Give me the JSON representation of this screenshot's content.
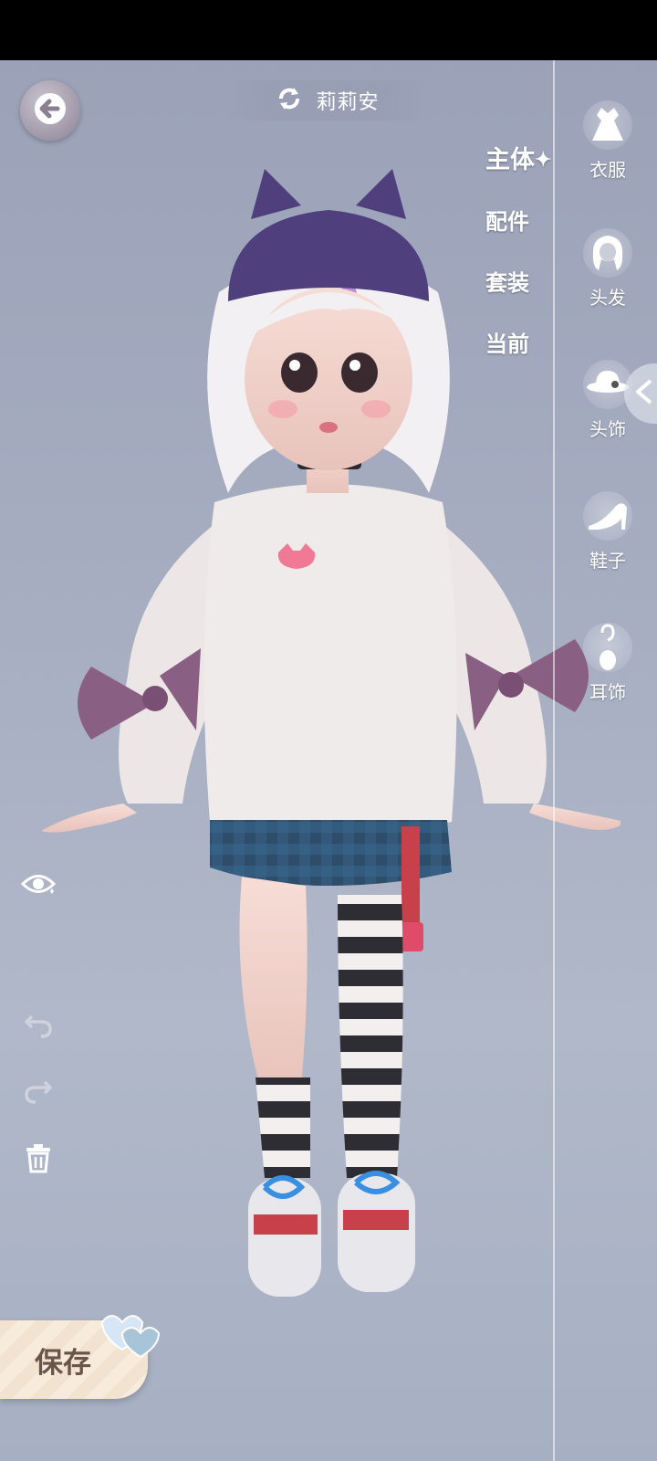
{
  "header": {
    "character_name": "莉莉安",
    "back_icon": "arrow-left-icon",
    "swap_icon": "refresh-icon"
  },
  "category_nav": {
    "items": [
      {
        "label": "主体",
        "active": true
      },
      {
        "label": "配件",
        "active": false
      },
      {
        "label": "套装",
        "active": false
      },
      {
        "label": "当前",
        "active": false
      }
    ]
  },
  "right_rail": {
    "items": [
      {
        "label": "衣服",
        "icon": "dress-icon"
      },
      {
        "label": "头发",
        "icon": "hair-icon"
      },
      {
        "label": "头饰",
        "icon": "hat-icon"
      },
      {
        "label": "鞋子",
        "icon": "high-heel-icon"
      },
      {
        "label": "耳饰",
        "icon": "earring-icon"
      }
    ],
    "collapse_icon": "chevron-left-icon"
  },
  "left_tools": {
    "items": [
      {
        "icon": "eye-icon"
      },
      {
        "icon": "undo-icon"
      },
      {
        "icon": "redo-icon"
      },
      {
        "icon": "trash-icon"
      }
    ]
  },
  "footer": {
    "save_label": "保存"
  },
  "colors": {
    "background": "#a6adc1",
    "save_button": "#f3e6d4",
    "save_text": "#6b5449",
    "hat": "#4f3f7c",
    "bow": "#8a5f84"
  }
}
